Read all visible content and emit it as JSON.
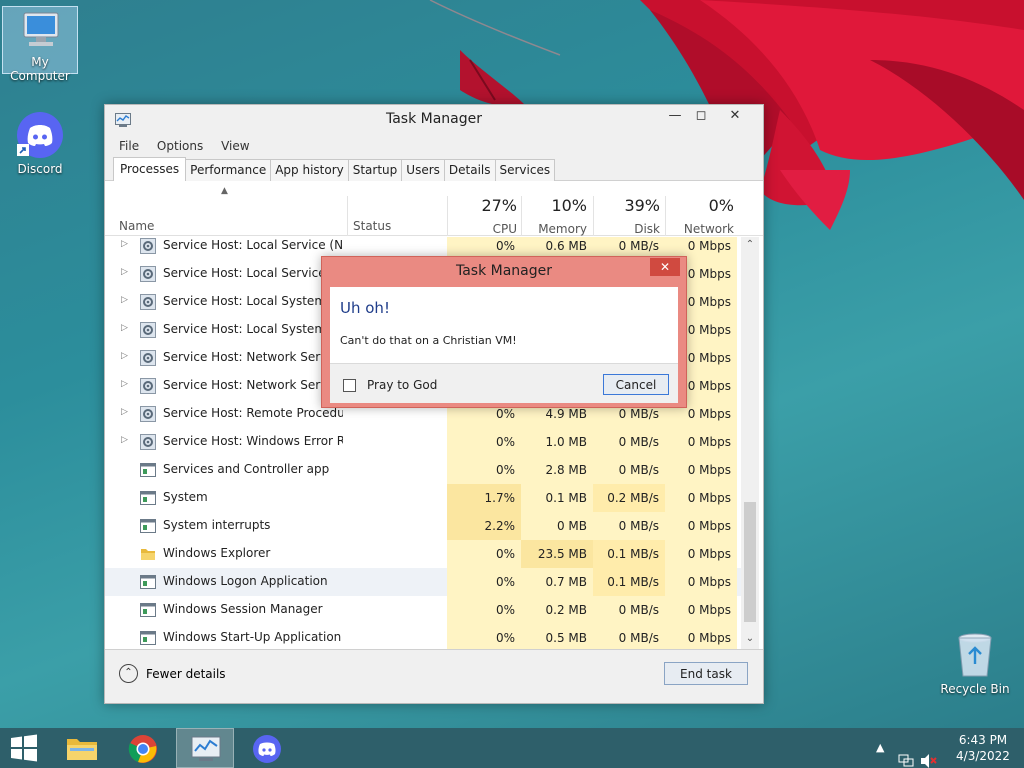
{
  "desktop": {
    "icons": [
      {
        "label": "My Computer"
      },
      {
        "label": "Discord"
      },
      {
        "label": "Recycle Bin"
      }
    ]
  },
  "task_manager": {
    "title": "Task Manager",
    "menu": [
      "File",
      "Options",
      "View"
    ],
    "tabs": [
      "Processes",
      "Performance",
      "App history",
      "Startup",
      "Users",
      "Details",
      "Services"
    ],
    "active_tab": "Processes",
    "columns": {
      "name": "Name",
      "status": "Status",
      "cpu": {
        "pct": "27%",
        "label": "CPU"
      },
      "memory": {
        "pct": "10%",
        "label": "Memory"
      },
      "disk": {
        "pct": "39%",
        "label": "Disk"
      },
      "network": {
        "pct": "0%",
        "label": "Network"
      }
    },
    "rows": [
      {
        "name": "Service Host: Local Service (No I...",
        "cpu": "0%",
        "mem": "0.6 MB",
        "disk": "0 MB/s",
        "net": "0 Mbps"
      },
      {
        "name": "Service Host: Local Service (No",
        "cpu": "",
        "mem": "",
        "disk": "",
        "net": "0 Mbps"
      },
      {
        "name": "Service Host: Local System (15",
        "cpu": "",
        "mem": "",
        "disk": "",
        "net": "0 Mbps"
      },
      {
        "name": "Service Host: Local System (Ne",
        "cpu": "",
        "mem": "",
        "disk": "",
        "net": "0 Mbps"
      },
      {
        "name": "Service Host: Network Service",
        "cpu": "",
        "mem": "",
        "disk": "",
        "net": "0 Mbps"
      },
      {
        "name": "Service Host: Network Service",
        "cpu": "",
        "mem": "",
        "disk": "",
        "net": "0 Mbps"
      },
      {
        "name": "Service Host: Remote Procedure...",
        "cpu": "0%",
        "mem": "4.9 MB",
        "disk": "0 MB/s",
        "net": "0 Mbps"
      },
      {
        "name": "Service Host: Windows Error Re...",
        "cpu": "0%",
        "mem": "1.0 MB",
        "disk": "0 MB/s",
        "net": "0 Mbps"
      },
      {
        "name": "Services and Controller app",
        "cpu": "0%",
        "mem": "2.8 MB",
        "disk": "0 MB/s",
        "net": "0 Mbps"
      },
      {
        "name": "System",
        "cpu": "1.7%",
        "mem": "0.1 MB",
        "disk": "0.2 MB/s",
        "net": "0 Mbps"
      },
      {
        "name": "System interrupts",
        "cpu": "2.2%",
        "mem": "0 MB",
        "disk": "0 MB/s",
        "net": "0 Mbps"
      },
      {
        "name": "Windows Explorer",
        "cpu": "0%",
        "mem": "23.5 MB",
        "disk": "0.1 MB/s",
        "net": "0 Mbps"
      },
      {
        "name": "Windows Logon Application",
        "cpu": "0%",
        "mem": "0.7 MB",
        "disk": "0.1 MB/s",
        "net": "0 Mbps"
      },
      {
        "name": "Windows Session Manager",
        "cpu": "0%",
        "mem": "0.2 MB",
        "disk": "0 MB/s",
        "net": "0 Mbps"
      },
      {
        "name": "Windows Start-Up Application",
        "cpu": "0%",
        "mem": "0.5 MB",
        "disk": "0 MB/s",
        "net": "0 Mbps"
      }
    ],
    "fewer_details": "Fewer details",
    "end_task": "End task"
  },
  "dialog": {
    "title": "Task Manager",
    "heading": "Uh oh!",
    "message": "Can't do that on a Christian VM!",
    "checkbox_label": "Pray to God",
    "cancel": "Cancel"
  },
  "taskbar": {
    "time": "6:43 PM",
    "date": "4/3/2022"
  }
}
